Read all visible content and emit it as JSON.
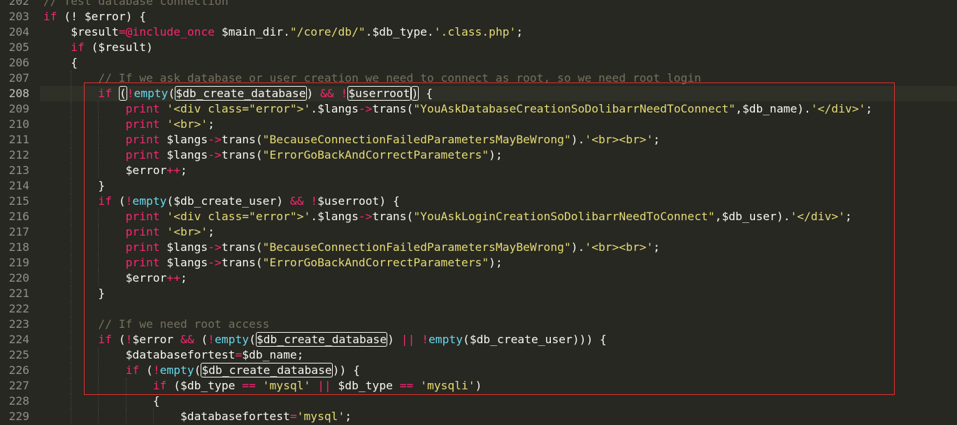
{
  "editor": {
    "language": "php",
    "theme_colors": {
      "background": "#272822",
      "keyword": "#f92672",
      "function": "#66d9ef",
      "string": "#e6db74",
      "comment": "#75715e",
      "text": "#f8f8f2",
      "highlight_frame": "#e0312f"
    },
    "active_line": 208,
    "lines": [
      {
        "num": "202",
        "indent": 0,
        "tokens": [
          {
            "t": "cm",
            "v": "// Test database connection"
          }
        ]
      },
      {
        "num": "203",
        "indent": 0,
        "tokens": [
          {
            "t": "kw",
            "v": "if"
          },
          {
            "t": "var",
            "v": " (! $error) {"
          }
        ]
      },
      {
        "num": "204",
        "indent": 1,
        "tokens": [
          {
            "t": "var",
            "v": "$result"
          },
          {
            "t": "op",
            "v": "=@include_once"
          },
          {
            "t": "var",
            "v": " $main_dir."
          },
          {
            "t": "str",
            "v": "\"/core/db/\""
          },
          {
            "t": "var",
            "v": ".$db_type."
          },
          {
            "t": "str",
            "v": "'.class.php'"
          },
          {
            "t": "var",
            "v": ";"
          }
        ]
      },
      {
        "num": "205",
        "indent": 1,
        "tokens": [
          {
            "t": "kw",
            "v": "if"
          },
          {
            "t": "var",
            "v": " ($result)"
          }
        ]
      },
      {
        "num": "206",
        "indent": 1,
        "tokens": [
          {
            "t": "var",
            "v": "{"
          }
        ]
      },
      {
        "num": "207",
        "indent": 2,
        "tokens": [
          {
            "t": "cm",
            "v": "// If we ask database or user creation we need to connect as root, so we need root login"
          }
        ]
      },
      {
        "num": "208",
        "indent": 2,
        "tokens": [
          {
            "t": "kw",
            "v": "if"
          },
          {
            "t": "var",
            "v": " "
          },
          {
            "t": "var",
            "v": "(",
            "box": true
          },
          {
            "t": "op",
            "v": "!"
          },
          {
            "t": "fn",
            "v": "empty"
          },
          {
            "t": "var",
            "v": "("
          },
          {
            "t": "var",
            "v": "$db_create_database",
            "box": true
          },
          {
            "t": "var",
            "v": ") "
          },
          {
            "t": "op",
            "v": "&&"
          },
          {
            "t": "var",
            "v": " "
          },
          {
            "t": "op",
            "v": "!"
          },
          {
            "t": "var",
            "v": "$userroot",
            "box": true
          },
          {
            "t": "var",
            "v": ")",
            "box": true
          },
          {
            "t": "var",
            "v": " {"
          }
        ]
      },
      {
        "num": "209",
        "indent": 3,
        "tokens": [
          {
            "t": "kw",
            "v": "print"
          },
          {
            "t": "var",
            "v": " "
          },
          {
            "t": "str",
            "v": "'<div class=\"error\">'"
          },
          {
            "t": "var",
            "v": ".$langs"
          },
          {
            "t": "op",
            "v": "->"
          },
          {
            "t": "var",
            "v": "trans("
          },
          {
            "t": "str",
            "v": "\"YouAskDatabaseCreationSoDolibarrNeedToConnect\""
          },
          {
            "t": "var",
            "v": ",$db_name)."
          },
          {
            "t": "str",
            "v": "'</div>'"
          },
          {
            "t": "var",
            "v": ";"
          }
        ]
      },
      {
        "num": "210",
        "indent": 3,
        "tokens": [
          {
            "t": "kw",
            "v": "print"
          },
          {
            "t": "var",
            "v": " "
          },
          {
            "t": "str",
            "v": "'<br>'"
          },
          {
            "t": "var",
            "v": ";"
          }
        ]
      },
      {
        "num": "211",
        "indent": 3,
        "tokens": [
          {
            "t": "kw",
            "v": "print"
          },
          {
            "t": "var",
            "v": " $langs"
          },
          {
            "t": "op",
            "v": "->"
          },
          {
            "t": "var",
            "v": "trans("
          },
          {
            "t": "str",
            "v": "\"BecauseConnectionFailedParametersMayBeWrong\""
          },
          {
            "t": "var",
            "v": ")."
          },
          {
            "t": "str",
            "v": "'<br><br>'"
          },
          {
            "t": "var",
            "v": ";"
          }
        ]
      },
      {
        "num": "212",
        "indent": 3,
        "tokens": [
          {
            "t": "kw",
            "v": "print"
          },
          {
            "t": "var",
            "v": " $langs"
          },
          {
            "t": "op",
            "v": "->"
          },
          {
            "t": "var",
            "v": "trans("
          },
          {
            "t": "str",
            "v": "\"ErrorGoBackAndCorrectParameters\""
          },
          {
            "t": "var",
            "v": ");"
          }
        ]
      },
      {
        "num": "213",
        "indent": 3,
        "tokens": [
          {
            "t": "var",
            "v": "$error"
          },
          {
            "t": "op",
            "v": "++"
          },
          {
            "t": "var",
            "v": ";"
          }
        ]
      },
      {
        "num": "214",
        "indent": 2,
        "tokens": [
          {
            "t": "var",
            "v": "}"
          }
        ]
      },
      {
        "num": "215",
        "indent": 2,
        "tokens": [
          {
            "t": "kw",
            "v": "if"
          },
          {
            "t": "var",
            "v": " ("
          },
          {
            "t": "op",
            "v": "!"
          },
          {
            "t": "fn",
            "v": "empty"
          },
          {
            "t": "var",
            "v": "($db_create_user) "
          },
          {
            "t": "op",
            "v": "&&"
          },
          {
            "t": "var",
            "v": " "
          },
          {
            "t": "op",
            "v": "!"
          },
          {
            "t": "var",
            "v": "$userroot) {"
          }
        ]
      },
      {
        "num": "216",
        "indent": 3,
        "tokens": [
          {
            "t": "kw",
            "v": "print"
          },
          {
            "t": "var",
            "v": " "
          },
          {
            "t": "str",
            "v": "'<div class=\"error\">'"
          },
          {
            "t": "var",
            "v": ".$langs"
          },
          {
            "t": "op",
            "v": "->"
          },
          {
            "t": "var",
            "v": "trans("
          },
          {
            "t": "str",
            "v": "\"YouAskLoginCreationSoDolibarrNeedToConnect\""
          },
          {
            "t": "var",
            "v": ",$db_user)."
          },
          {
            "t": "str",
            "v": "'</div>'"
          },
          {
            "t": "var",
            "v": ";"
          }
        ]
      },
      {
        "num": "217",
        "indent": 3,
        "tokens": [
          {
            "t": "kw",
            "v": "print"
          },
          {
            "t": "var",
            "v": " "
          },
          {
            "t": "str",
            "v": "'<br>'"
          },
          {
            "t": "var",
            "v": ";"
          }
        ]
      },
      {
        "num": "218",
        "indent": 3,
        "tokens": [
          {
            "t": "kw",
            "v": "print"
          },
          {
            "t": "var",
            "v": " $langs"
          },
          {
            "t": "op",
            "v": "->"
          },
          {
            "t": "var",
            "v": "trans("
          },
          {
            "t": "str",
            "v": "\"BecauseConnectionFailedParametersMayBeWrong\""
          },
          {
            "t": "var",
            "v": ")."
          },
          {
            "t": "str",
            "v": "'<br><br>'"
          },
          {
            "t": "var",
            "v": ";"
          }
        ]
      },
      {
        "num": "219",
        "indent": 3,
        "tokens": [
          {
            "t": "kw",
            "v": "print"
          },
          {
            "t": "var",
            "v": " $langs"
          },
          {
            "t": "op",
            "v": "->"
          },
          {
            "t": "var",
            "v": "trans("
          },
          {
            "t": "str",
            "v": "\"ErrorGoBackAndCorrectParameters\""
          },
          {
            "t": "var",
            "v": ");"
          }
        ]
      },
      {
        "num": "220",
        "indent": 3,
        "tokens": [
          {
            "t": "var",
            "v": "$error"
          },
          {
            "t": "op",
            "v": "++"
          },
          {
            "t": "var",
            "v": ";"
          }
        ]
      },
      {
        "num": "221",
        "indent": 2,
        "tokens": [
          {
            "t": "var",
            "v": "}"
          }
        ]
      },
      {
        "num": "222",
        "indent": 2,
        "tokens": []
      },
      {
        "num": "223",
        "indent": 2,
        "tokens": [
          {
            "t": "cm",
            "v": "// If we need root access"
          }
        ]
      },
      {
        "num": "224",
        "indent": 2,
        "tokens": [
          {
            "t": "kw",
            "v": "if"
          },
          {
            "t": "var",
            "v": " ("
          },
          {
            "t": "op",
            "v": "!"
          },
          {
            "t": "var",
            "v": "$error "
          },
          {
            "t": "op",
            "v": "&&"
          },
          {
            "t": "var",
            "v": " ("
          },
          {
            "t": "op",
            "v": "!"
          },
          {
            "t": "fn",
            "v": "empty"
          },
          {
            "t": "var",
            "v": "("
          },
          {
            "t": "var",
            "v": "$db_create_database",
            "box": true
          },
          {
            "t": "var",
            "v": ") "
          },
          {
            "t": "op",
            "v": "||"
          },
          {
            "t": "var",
            "v": " "
          },
          {
            "t": "op",
            "v": "!"
          },
          {
            "t": "fn",
            "v": "empty"
          },
          {
            "t": "var",
            "v": "($db_create_user))) {"
          }
        ]
      },
      {
        "num": "225",
        "indent": 3,
        "tokens": [
          {
            "t": "var",
            "v": "$databasefortest"
          },
          {
            "t": "op",
            "v": "="
          },
          {
            "t": "var",
            "v": "$db_name;"
          }
        ]
      },
      {
        "num": "226",
        "indent": 3,
        "tokens": [
          {
            "t": "kw",
            "v": "if"
          },
          {
            "t": "var",
            "v": " ("
          },
          {
            "t": "op",
            "v": "!"
          },
          {
            "t": "fn",
            "v": "empty"
          },
          {
            "t": "var",
            "v": "("
          },
          {
            "t": "var",
            "v": "$db_create_database",
            "box": true
          },
          {
            "t": "var",
            "v": ")) {"
          }
        ]
      },
      {
        "num": "227",
        "indent": 4,
        "tokens": [
          {
            "t": "kw",
            "v": "if"
          },
          {
            "t": "var",
            "v": " ($db_type "
          },
          {
            "t": "op",
            "v": "=="
          },
          {
            "t": "var",
            "v": " "
          },
          {
            "t": "str",
            "v": "'mysql'"
          },
          {
            "t": "var",
            "v": " "
          },
          {
            "t": "op",
            "v": "||"
          },
          {
            "t": "var",
            "v": " $db_type "
          },
          {
            "t": "op",
            "v": "=="
          },
          {
            "t": "var",
            "v": " "
          },
          {
            "t": "str",
            "v": "'mysqli'"
          },
          {
            "t": "var",
            "v": ")"
          }
        ]
      },
      {
        "num": "228",
        "indent": 4,
        "tokens": [
          {
            "t": "var",
            "v": "{"
          }
        ]
      },
      {
        "num": "229",
        "indent": 5,
        "tokens": [
          {
            "t": "var",
            "v": "$databasefortest"
          },
          {
            "t": "op",
            "v": "="
          },
          {
            "t": "str",
            "v": "'mysql'"
          },
          {
            "t": "var",
            "v": ";"
          }
        ]
      }
    ]
  }
}
